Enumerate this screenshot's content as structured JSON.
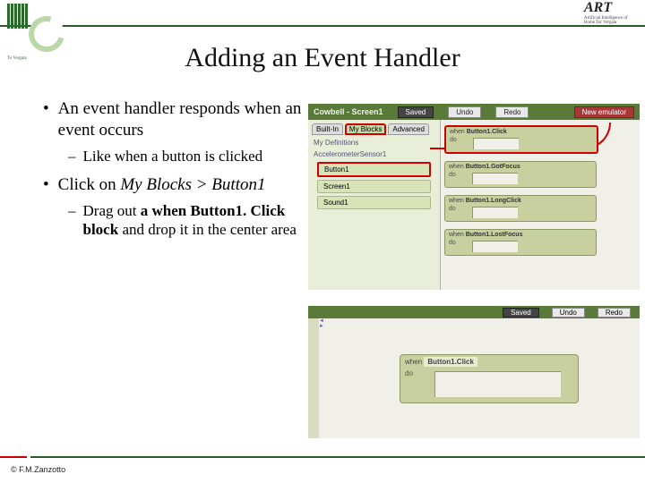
{
  "header": {
    "left_logo_bottom": "To Vergata",
    "right_logo_title": "ART",
    "right_logo_sub": "Artificial Intelligence of Rome Tor Vergata"
  },
  "title": "Adding an Event Handler",
  "bullets": {
    "b1": "An event handler responds when an event occurs",
    "b1_sub": "Like when a button is clicked",
    "b2_pre": "Click on ",
    "b2_em": "My Blocks > Button1",
    "b2_sub_pre": "Drag out ",
    "b2_sub_bold": "a when Button1. Click block",
    "b2_sub_post": " and drop it in the center area"
  },
  "shot1": {
    "topbar_title": "Cowbell - Screen1",
    "btn_saved": "Saved",
    "btn_undo": "Undo",
    "btn_redo": "Redo",
    "btn_new": "New emulator",
    "tab_builtin": "Built-In",
    "tab_myblocks": "My Blocks",
    "tab_advanced": "Advanced",
    "cat_defs": "My Definitions",
    "cat_accel": "AccelerometerSensor1",
    "cat_button": "Button1",
    "cat_screen": "Screen1",
    "cat_sound": "Sound1",
    "blk_when": "when",
    "blk_do": "do",
    "blk1": "Button1.Click",
    "blk2": "Button1.GotFocus",
    "blk3": "Button1.LongClick",
    "blk4": "Button1.LostFocus"
  },
  "shot2": {
    "btn_saved": "Saved",
    "btn_undo": "Undo",
    "btn_redo": "Redo",
    "when": "when",
    "label": "Button1.Click",
    "do": "do"
  },
  "footer": "© F.M.Zanzotto"
}
